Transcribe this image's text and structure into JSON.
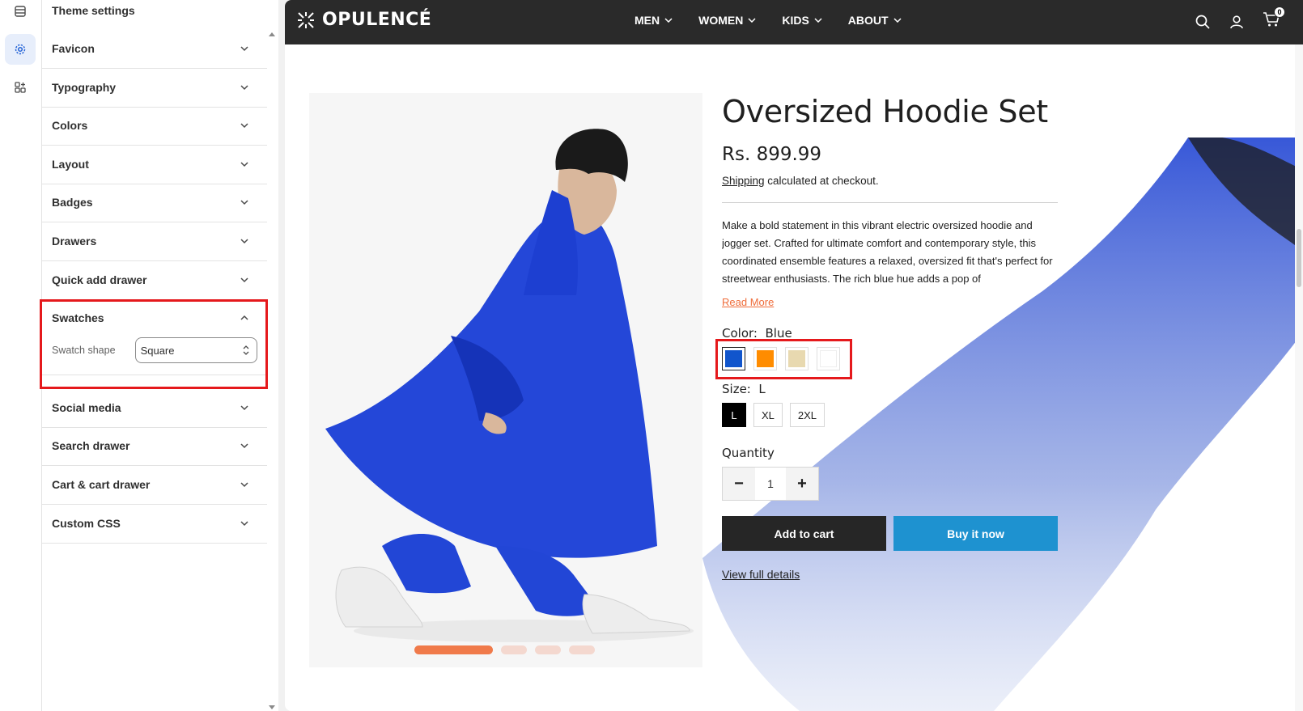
{
  "sidebar": {
    "title": "Theme settings",
    "sections": [
      {
        "label": "Favicon"
      },
      {
        "label": "Typography"
      },
      {
        "label": "Colors"
      },
      {
        "label": "Layout"
      },
      {
        "label": "Badges"
      },
      {
        "label": "Drawers"
      },
      {
        "label": "Quick add drawer"
      },
      {
        "label": "Swatches"
      },
      {
        "label": "Social media"
      },
      {
        "label": "Search drawer"
      },
      {
        "label": "Cart & cart drawer"
      },
      {
        "label": "Custom CSS"
      }
    ],
    "swatches_setting": {
      "label": "Swatch shape",
      "value": "Square"
    }
  },
  "store": {
    "logo": "OPULENCÉ",
    "nav": [
      "MEN",
      "WOMEN",
      "KIDS",
      "ABOUT"
    ],
    "cart_count": "0"
  },
  "product": {
    "title": "Oversized Hoodie Set",
    "price": "Rs. 899.99",
    "shipping_link": "Shipping",
    "shipping_rest": " calculated at checkout.",
    "description": "Make a bold statement in this vibrant electric oversized hoodie and jogger set. Crafted for ultimate comfort and contemporary style, this coordinated ensemble features a relaxed, oversized fit that's perfect for streetwear enthusiasts. The rich blue hue adds a pop of",
    "read_more": "Read More",
    "color_label": "Color:",
    "color_value": "Blue",
    "swatch_colors": [
      "#1155cc",
      "#ff8c00",
      "#e8d9b0",
      "#ffffff"
    ],
    "size_label": "Size:",
    "size_value": "L",
    "sizes": [
      "L",
      "XL",
      "2XL"
    ],
    "quantity_label": "Quantity",
    "quantity": "1",
    "minus": "−",
    "plus": "+",
    "add_to_cart": "Add to cart",
    "buy_now": "Buy it now",
    "view_full": "View full details"
  },
  "colors": {
    "header_bg": "#2a2a2a",
    "accent_orange": "#ef6c3a",
    "buy_button": "#1e92d0",
    "highlight_red": "#e5191c",
    "garment_blue": "#1d3fd0"
  }
}
